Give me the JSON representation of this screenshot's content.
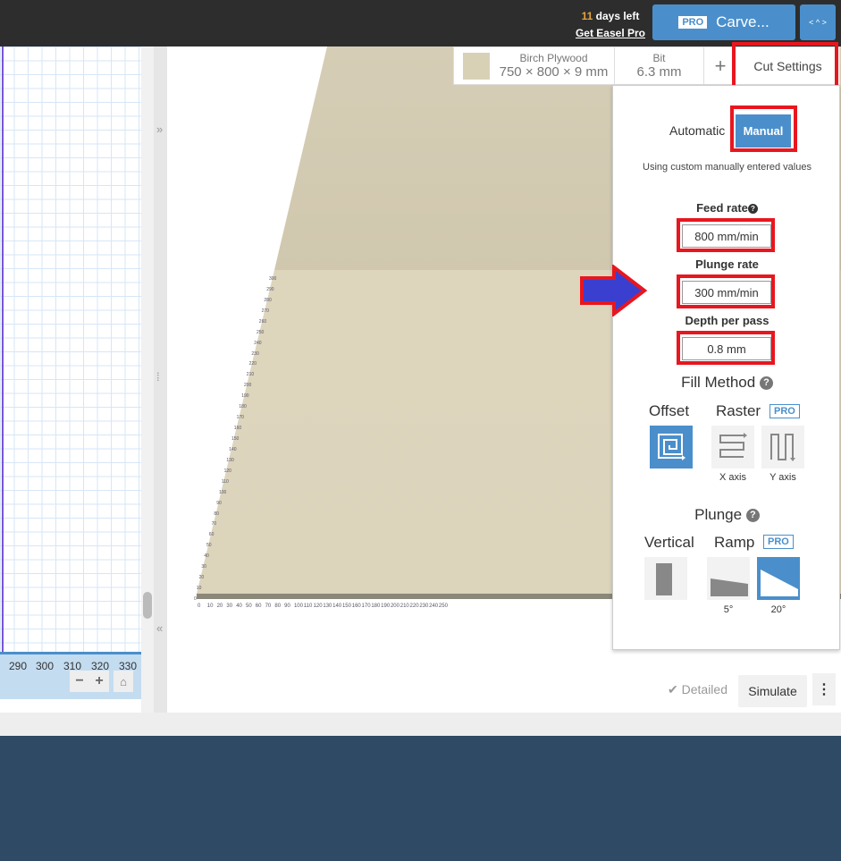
{
  "header": {
    "days_num": "11",
    "days_text": " days left",
    "get_pro": "Get Easel Pro",
    "carve_badge": "PRO",
    "carve_label": "Carve...",
    "expand_icon": "expand-arrows-icon"
  },
  "material": {
    "name": "Birch Plywood",
    "dims": "750 × 800 × 9 mm",
    "swatch_color": "#d9d1b6"
  },
  "bit": {
    "label": "Bit",
    "value": "6.3 mm"
  },
  "add_label": "+",
  "cut_settings_label": "Cut Settings",
  "grid": {
    "ruler_labels": [
      "290",
      "300",
      "310",
      "320",
      "330"
    ],
    "zoom_out": "−",
    "zoom_in": "+"
  },
  "preview": {
    "x_ticks": {
      "start": 0,
      "end": 250,
      "step": 10
    },
    "y_ticks": {
      "start": 0,
      "end": 300,
      "step": 10
    }
  },
  "panel": {
    "mode_automatic": "Automatic",
    "mode_manual": "Manual",
    "mode_selected": "Manual",
    "note": "Using custom manually entered values",
    "feed_rate_label": "Feed rate",
    "feed_rate": "800 mm/min",
    "plunge_rate_label": "Plunge rate",
    "plunge_rate": "300 mm/min",
    "depth_label": "Depth per pass",
    "depth": "0.8 mm",
    "fill_method": "Fill Method",
    "offset": "Offset",
    "raster": "Raster",
    "pro": "PRO",
    "x_axis": "X axis",
    "y_axis": "Y axis",
    "fill_selected": "Offset",
    "plunge": "Plunge",
    "vertical": "Vertical",
    "ramp": "Ramp",
    "ramp_5": "5°",
    "ramp_20": "20°",
    "plunge_selected": "20°",
    "help": "?"
  },
  "footer": {
    "detailed": "Detailed",
    "simulate": "Simulate",
    "more": "⋮"
  },
  "colors": {
    "accent": "#4a8fcb",
    "highlight": "#e8161f",
    "arrow": "#3b3fcf",
    "topbar": "#2d2d2d",
    "background": "#2e4a64"
  }
}
